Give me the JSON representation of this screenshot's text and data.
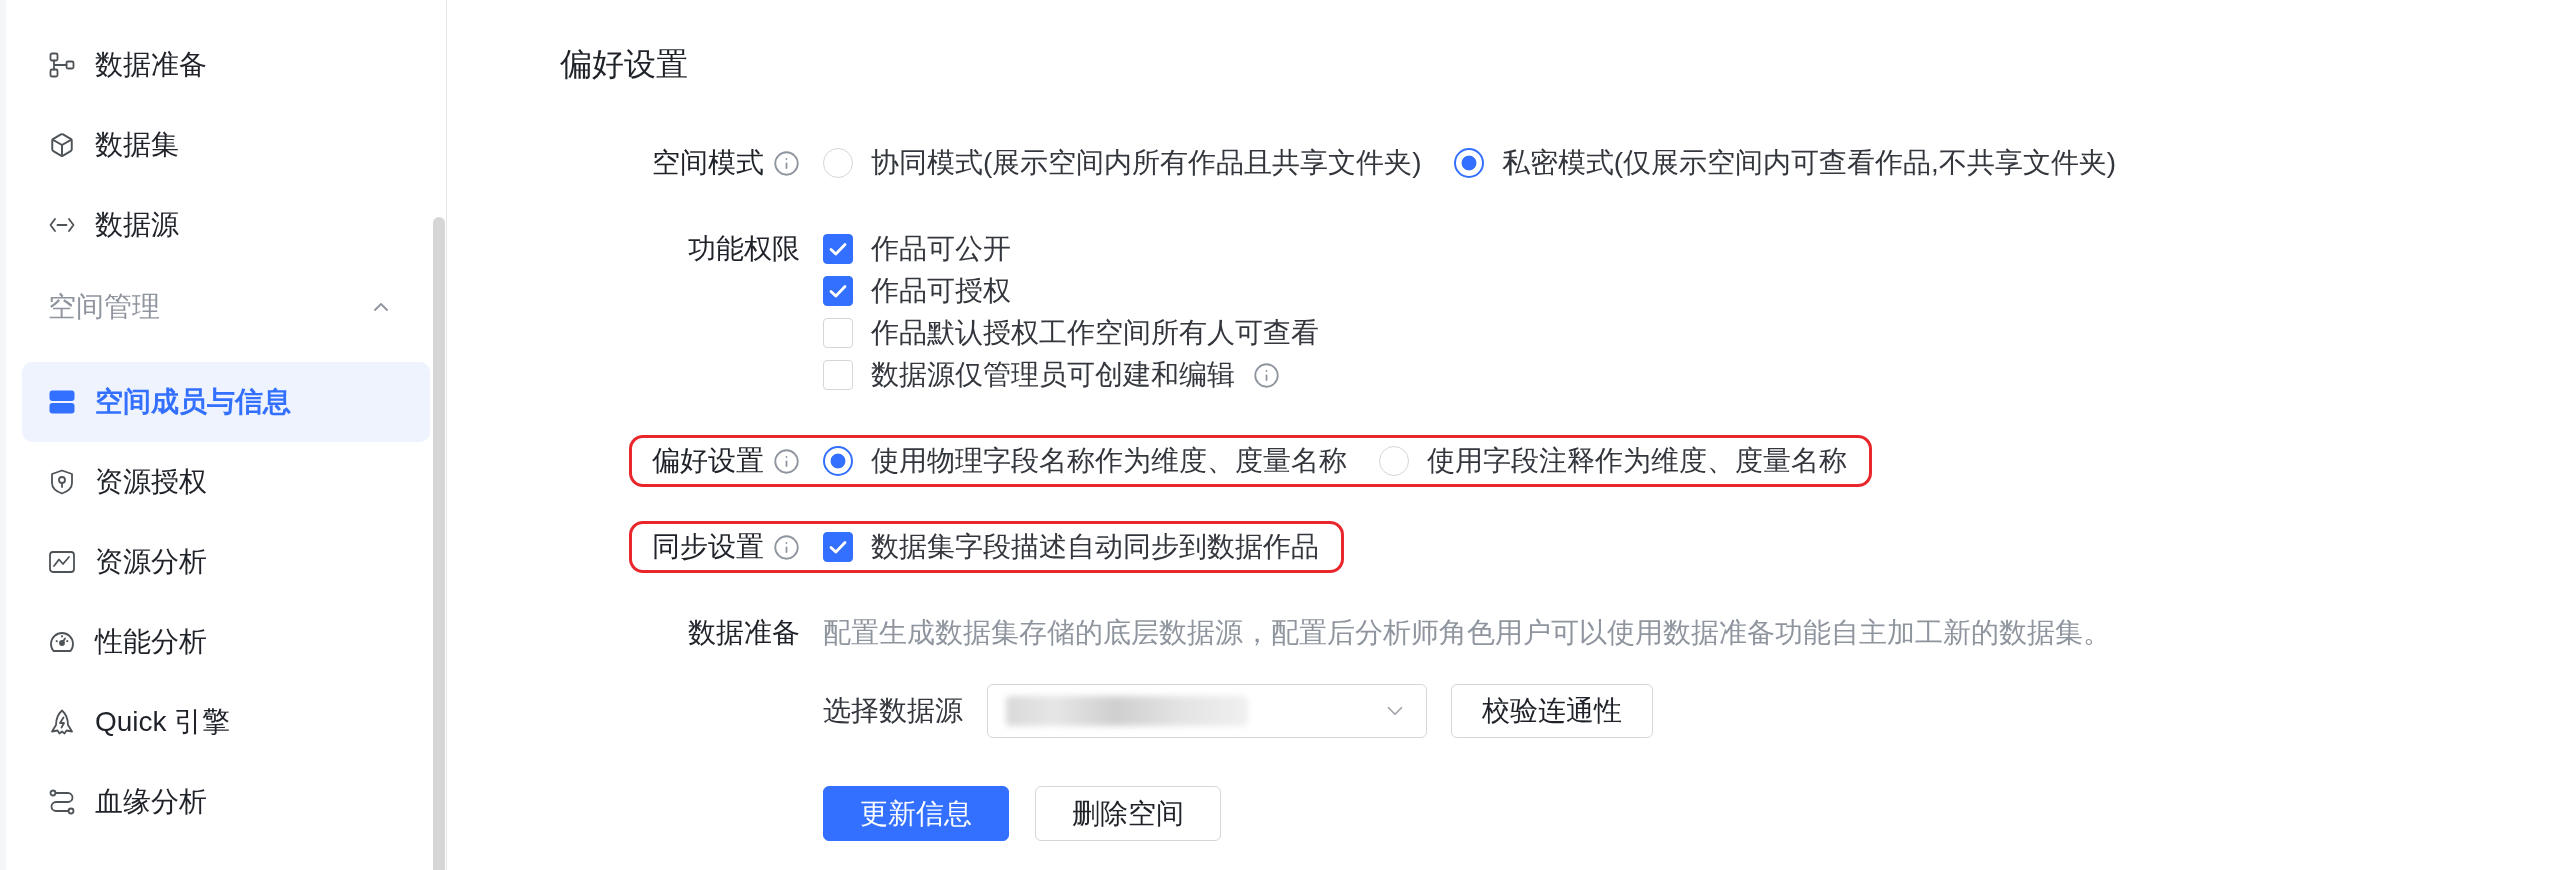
{
  "sidebar": {
    "items": [
      {
        "kind": "item",
        "label": "数据准备",
        "selected": false
      },
      {
        "kind": "item",
        "label": "数据集",
        "selected": false
      },
      {
        "kind": "item",
        "label": "数据源",
        "selected": false
      },
      {
        "kind": "group",
        "label": "空间管理",
        "expanded": true,
        "children": [
          {
            "label": "空间成员与信息",
            "selected": true
          },
          {
            "label": "资源授权",
            "selected": false
          },
          {
            "label": "资源分析",
            "selected": false
          },
          {
            "label": "性能分析",
            "selected": false
          },
          {
            "label": "Quick 引擎",
            "selected": false
          },
          {
            "label": "血缘分析",
            "selected": false
          }
        ]
      }
    ]
  },
  "page": {
    "title": "偏好设置",
    "rows": [
      {
        "kind": "radio",
        "label": "空间模式",
        "info": true,
        "highlighted": false,
        "options": [
          {
            "label": "协同模式(展示空间内所有作品且共享文件夹)",
            "selected": false
          },
          {
            "label": "私密模式(仅展示空间内可查看作品,不共享文件夹)",
            "selected": true
          }
        ]
      },
      {
        "kind": "checkbox",
        "label": "功能权限",
        "highlighted": false,
        "options": [
          {
            "label": "作品可公开",
            "checked": true
          },
          {
            "label": "作品可授权",
            "checked": true
          },
          {
            "label": "作品默认授权工作空间所有人可查看",
            "checked": false
          },
          {
            "label": "数据源仅管理员可创建和编辑",
            "checked": false,
            "info": true
          }
        ]
      },
      {
        "kind": "radio",
        "label": "偏好设置",
        "info": true,
        "highlighted": true,
        "options": [
          {
            "label": "使用物理字段名称作为维度、度量名称",
            "selected": true
          },
          {
            "label": "使用字段注释作为维度、度量名称",
            "selected": false
          }
        ]
      },
      {
        "kind": "checkbox",
        "label": "同步设置",
        "info": true,
        "highlighted": true,
        "options": [
          {
            "label": "数据集字段描述自动同步到数据作品",
            "checked": true
          }
        ]
      },
      {
        "kind": "datasource",
        "label": "数据准备",
        "highlighted": false,
        "description": "配置生成数据集存储的底层数据源，配置后分析师角色用户可以使用数据准备功能自主加工新的数据集。",
        "field_label": "选择数据源",
        "redacted": true,
        "verify_button": "校验连通性"
      }
    ],
    "buttons": [
      {
        "label": "更新信息",
        "primary": true
      },
      {
        "label": "删除空间",
        "primary": false
      }
    ]
  }
}
